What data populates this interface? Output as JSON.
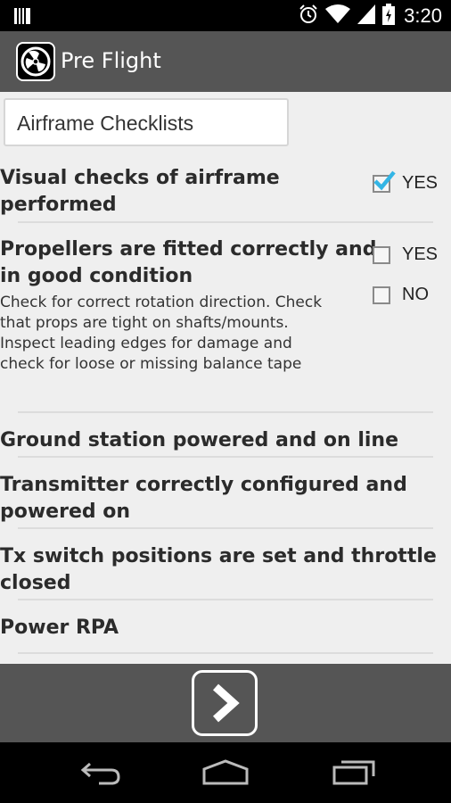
{
  "status_bar": {
    "time": "3:20",
    "icons": [
      "notification-icon",
      "alarm-icon",
      "wifi-icon",
      "signal-icon",
      "battery-icon"
    ]
  },
  "action_bar": {
    "title": "Pre Flight",
    "app_icon": "propeller-icon"
  },
  "section": {
    "title": "Airframe Checklists"
  },
  "checklist": [
    {
      "title_lines": [
        "Visual checks of airframe",
        "performed"
      ],
      "options": [
        {
          "label": "YES",
          "checked": true
        }
      ]
    },
    {
      "title_lines": [
        "Propellers are fitted correctly and",
        "in good condition"
      ],
      "description_lines": [
        "Check for correct rotation direction. Check",
        "that props are tight on shafts/mounts.",
        "Inspect leading edges for damage and",
        "check for loose or missing balance tape"
      ],
      "options": [
        {
          "label": "YES",
          "checked": false
        },
        {
          "label": "NO",
          "checked": false
        }
      ]
    },
    {
      "title_lines": [
        "Ground station powered and on line"
      ]
    },
    {
      "title_lines": [
        "Transmitter correctly configured and",
        "powered on"
      ]
    },
    {
      "title_lines": [
        "Tx switch positions are set and throttle",
        "closed"
      ]
    },
    {
      "title_lines": [
        "Power RPA"
      ]
    }
  ],
  "bottom_bar": {
    "next_icon": "chevron-right-icon"
  },
  "nav_bar": {
    "icons": [
      "back-icon",
      "home-icon",
      "recent-apps-icon"
    ]
  },
  "colors": {
    "action_bar": "#555555",
    "background": "#efefef",
    "check_accent": "#33b5e5"
  }
}
